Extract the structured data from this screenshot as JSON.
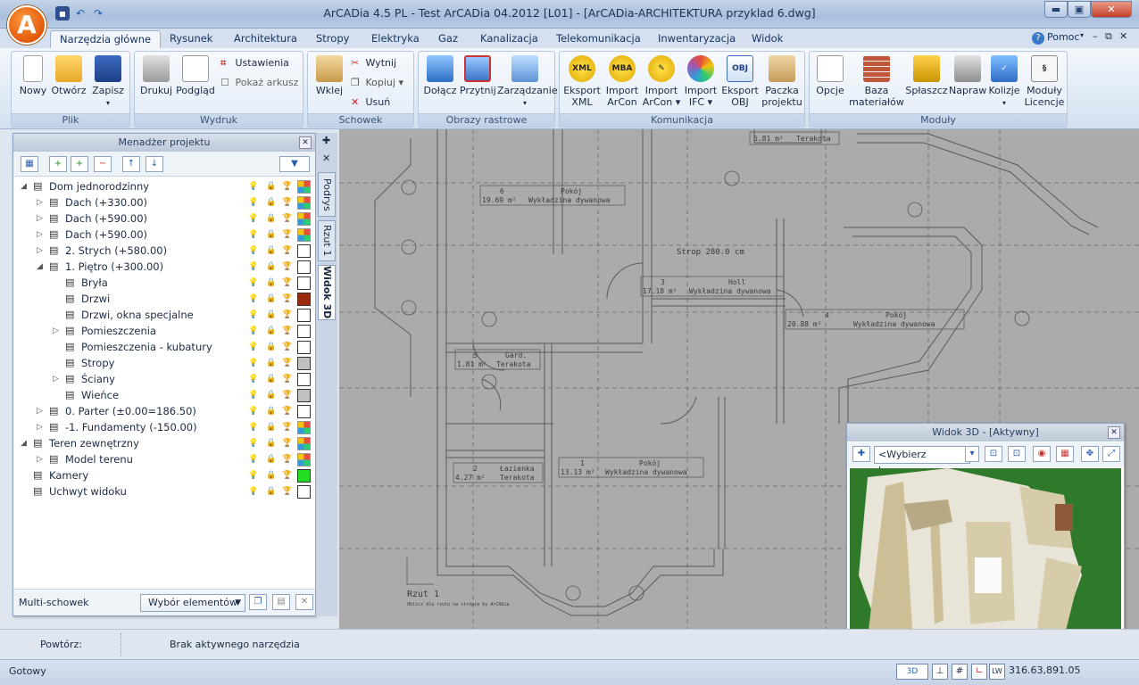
{
  "app": {
    "title": "ArCADia 4.5 PL - Test ArCADia 04.2012 [L01] - [ArCADia-ARCHITEKTURA przyklad 6.dwg]",
    "logo_letter": "A"
  },
  "tabs": [
    "Narzędzia główne",
    "Rysunek",
    "Architektura",
    "Stropy",
    "Elektryka",
    "Gaz",
    "Kanalizacja",
    "Telekomunikacja",
    "Inwentaryzacja",
    "Widok"
  ],
  "help": "Pomoc",
  "ribbon": {
    "plik": {
      "label": "Plik",
      "nowy": "Nowy",
      "otworz": "Otwórz",
      "zapisz": "Zapisz"
    },
    "wydruk": {
      "label": "Wydruk",
      "drukuj": "Drukuj",
      "podglad": "Podgląd",
      "ustawienia": "Ustawienia",
      "pokaz": "Pokaż arkusz"
    },
    "schowek": {
      "label": "Schowek",
      "wklej": "Wklej",
      "wytnij": "Wytnij",
      "kopiuj": "Kopiuj",
      "usun": "Usuń"
    },
    "obrazy": {
      "label": "Obrazy rastrowe",
      "dolacz": "Dołącz",
      "przytnij": "Przytnij",
      "zarzadzanie": "Zarządzanie"
    },
    "komunikacja": {
      "label": "Komunikacja",
      "eksport_xml_1": "Eksport",
      "eksport_xml_2": "XML",
      "import_arcon1_1": "Import",
      "import_arcon1_2": "ArCon",
      "import_arcon2_1": "Import",
      "import_arcon2_2": "ArCon",
      "import_ifc_1": "Import",
      "import_ifc_2": "IFC",
      "eksport_obj_1": "Eksport",
      "eksport_obj_2": "OBJ",
      "paczka_1": "Paczka",
      "paczka_2": "projektu",
      "xml_badge": "XML",
      "mba_badge": "MBA",
      "obj_badge": "OBJ"
    },
    "moduly": {
      "label": "Moduły",
      "opcje": "Opcje",
      "baza_1": "Baza",
      "baza_2": "materiałów",
      "splaszcz": "Spłaszcz",
      "napraw": "Napraw",
      "kolizje": "Kolizje",
      "moduly_1": "Moduły",
      "moduly_2": "Licencje"
    }
  },
  "project_manager": {
    "title": "Menadżer projektu",
    "tree": [
      {
        "label": "Dom jednorodzinny",
        "indent": 0,
        "exp": "◢",
        "swatch": "multi"
      },
      {
        "label": "Dach (+330.00)",
        "indent": 1,
        "exp": "▷",
        "swatch": "multi"
      },
      {
        "label": "Dach (+590.00)",
        "indent": 1,
        "exp": "▷",
        "swatch": "multi"
      },
      {
        "label": "Dach (+590.00)",
        "indent": 1,
        "exp": "▷",
        "swatch": "multi"
      },
      {
        "label": "2. Strych (+580.00)",
        "indent": 1,
        "exp": "▷",
        "swatch": "#ffffff"
      },
      {
        "label": "1. Piętro (+300.00)",
        "indent": 1,
        "exp": "◢",
        "swatch": "#ffffff"
      },
      {
        "label": "Bryła",
        "indent": 2,
        "exp": "",
        "swatch": "#ffffff"
      },
      {
        "label": "Drzwi",
        "indent": 2,
        "exp": "",
        "swatch": "#9b2a0e"
      },
      {
        "label": "Drzwi, okna specjalne",
        "indent": 2,
        "exp": "",
        "swatch": "#ffffff"
      },
      {
        "label": "Pomieszczenia",
        "indent": 2,
        "exp": "▷",
        "swatch": "#ffffff"
      },
      {
        "label": "Pomieszczenia - kubatury",
        "indent": 2,
        "exp": "",
        "swatch": "#ffffff"
      },
      {
        "label": "Stropy",
        "indent": 2,
        "exp": "",
        "swatch": "#c0c0c0"
      },
      {
        "label": "Ściany",
        "indent": 2,
        "exp": "▷",
        "swatch": "#ffffff"
      },
      {
        "label": "Wieńce",
        "indent": 2,
        "exp": "",
        "swatch": "#c0c0c0"
      },
      {
        "label": "0. Parter (±0.00=186.50)",
        "indent": 1,
        "exp": "▷",
        "swatch": "#ffffff"
      },
      {
        "label": "-1. Fundamenty (-150.00)",
        "indent": 1,
        "exp": "▷",
        "swatch": "multi"
      },
      {
        "label": "Teren zewnętrzny",
        "indent": 0,
        "exp": "◢",
        "swatch": "multi"
      },
      {
        "label": "Model terenu",
        "indent": 1,
        "exp": "▷",
        "swatch": "multi"
      },
      {
        "label": "Kamery",
        "indent": 0,
        "exp": "",
        "swatch": "#22dd22"
      },
      {
        "label": "Uchwyt widoku",
        "indent": 0,
        "exp": "",
        "swatch": "#ffffff"
      }
    ],
    "multi_label": "Multi-schowek",
    "select_label": "Wybór elementów"
  },
  "side_tabs": {
    "podrys": "Podrys",
    "rzut": "Rzut 1",
    "widok": "Widok 3D"
  },
  "drawing": {
    "rooms": [
      {
        "num": "6",
        "name": "Pokój",
        "area": "19.69 m²",
        "floor": "Wykładzina dywanowa"
      },
      {
        "num": "3",
        "name": "Holl",
        "area": "17.18 m²",
        "floor": "Wykładzina dywanowa"
      },
      {
        "num": "4",
        "name": "Pokój",
        "area": "20.88 m²",
        "floor": "Wykładzina dywanowa"
      },
      {
        "num": "5",
        "name": "Gard.",
        "area": "1.81 m²",
        "floor": "Terakota"
      },
      {
        "num": "2",
        "name": "Łazienka",
        "area": "4.27 m²",
        "floor": "Terakota"
      },
      {
        "num": "1",
        "name": "Pokój",
        "area": "13.13 m²",
        "floor": "Wykładzina dywanowa"
      },
      {
        "num": "",
        "name": "",
        "area": "5.81 m²",
        "floor": "Terakota"
      }
    ],
    "strop": "Strop 280.0 cm",
    "rzut": "Rzut 1",
    "note": "Oblicz dla rzutu na stropie by ArCADia"
  },
  "view3d": {
    "title": "Widok 3D - [Aktywny]",
    "camera": "<Wybierz kamerę>"
  },
  "status": {
    "powtorz": "Powtórz:",
    "tool": "Brak aktywnego narzędzia",
    "gotowy": "Gotowy",
    "coords": "316.63,891.05"
  }
}
